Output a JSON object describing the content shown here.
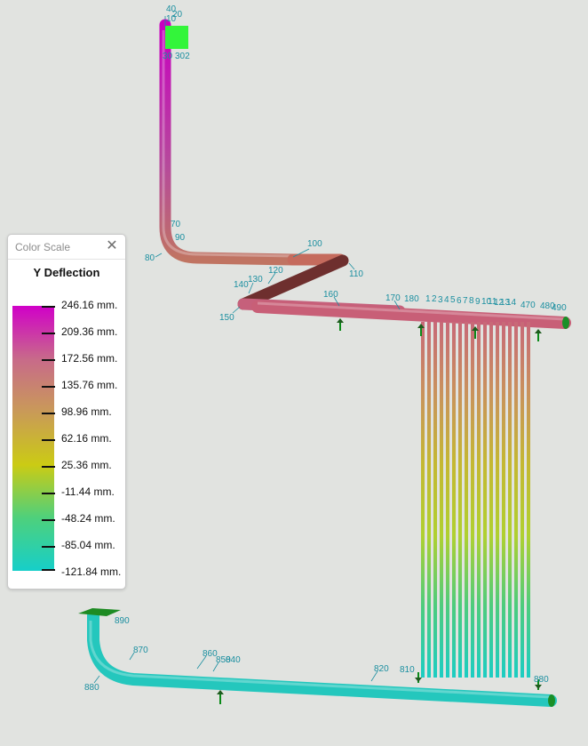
{
  "scene": {
    "colors": {
      "background": "#e1e3e0",
      "label": "#1b8fa0",
      "support": "#0a8a18",
      "support_head": "#1e5b1e",
      "anchor_block": "#33f53a"
    },
    "node_labels": [
      "40",
      "20",
      "10",
      "30",
      "302",
      "70",
      "90",
      "80",
      "100",
      "110",
      "120",
      "130",
      "140",
      "150",
      "160",
      "170",
      "180",
      "470",
      "480",
      "490",
      "860",
      "870",
      "880",
      "890",
      "850",
      "840",
      "820",
      "810",
      "880"
    ],
    "layer_labels": [
      "1",
      "2",
      "3",
      "4",
      "5",
      "6",
      "7",
      "8",
      "9",
      "10",
      "11",
      "12",
      "13",
      "14"
    ]
  },
  "color_scale": {
    "window_title": "Color Scale",
    "close_glyph": "✕",
    "heading": "Y Deflection",
    "gradient_colors": [
      "#d000c8",
      "#c86a8a",
      "#c99a58",
      "#cbcb14",
      "#4ed07c",
      "#16cfc9"
    ],
    "labels": [
      "246.16 mm.",
      "209.36 mm.",
      "172.56 mm.",
      "135.76 mm.",
      "98.96 mm.",
      "62.16 mm.",
      "25.36 mm.",
      "-11.44 mm.",
      "-48.24 mm.",
      "-85.04 mm.",
      "-121.84 mm."
    ]
  }
}
